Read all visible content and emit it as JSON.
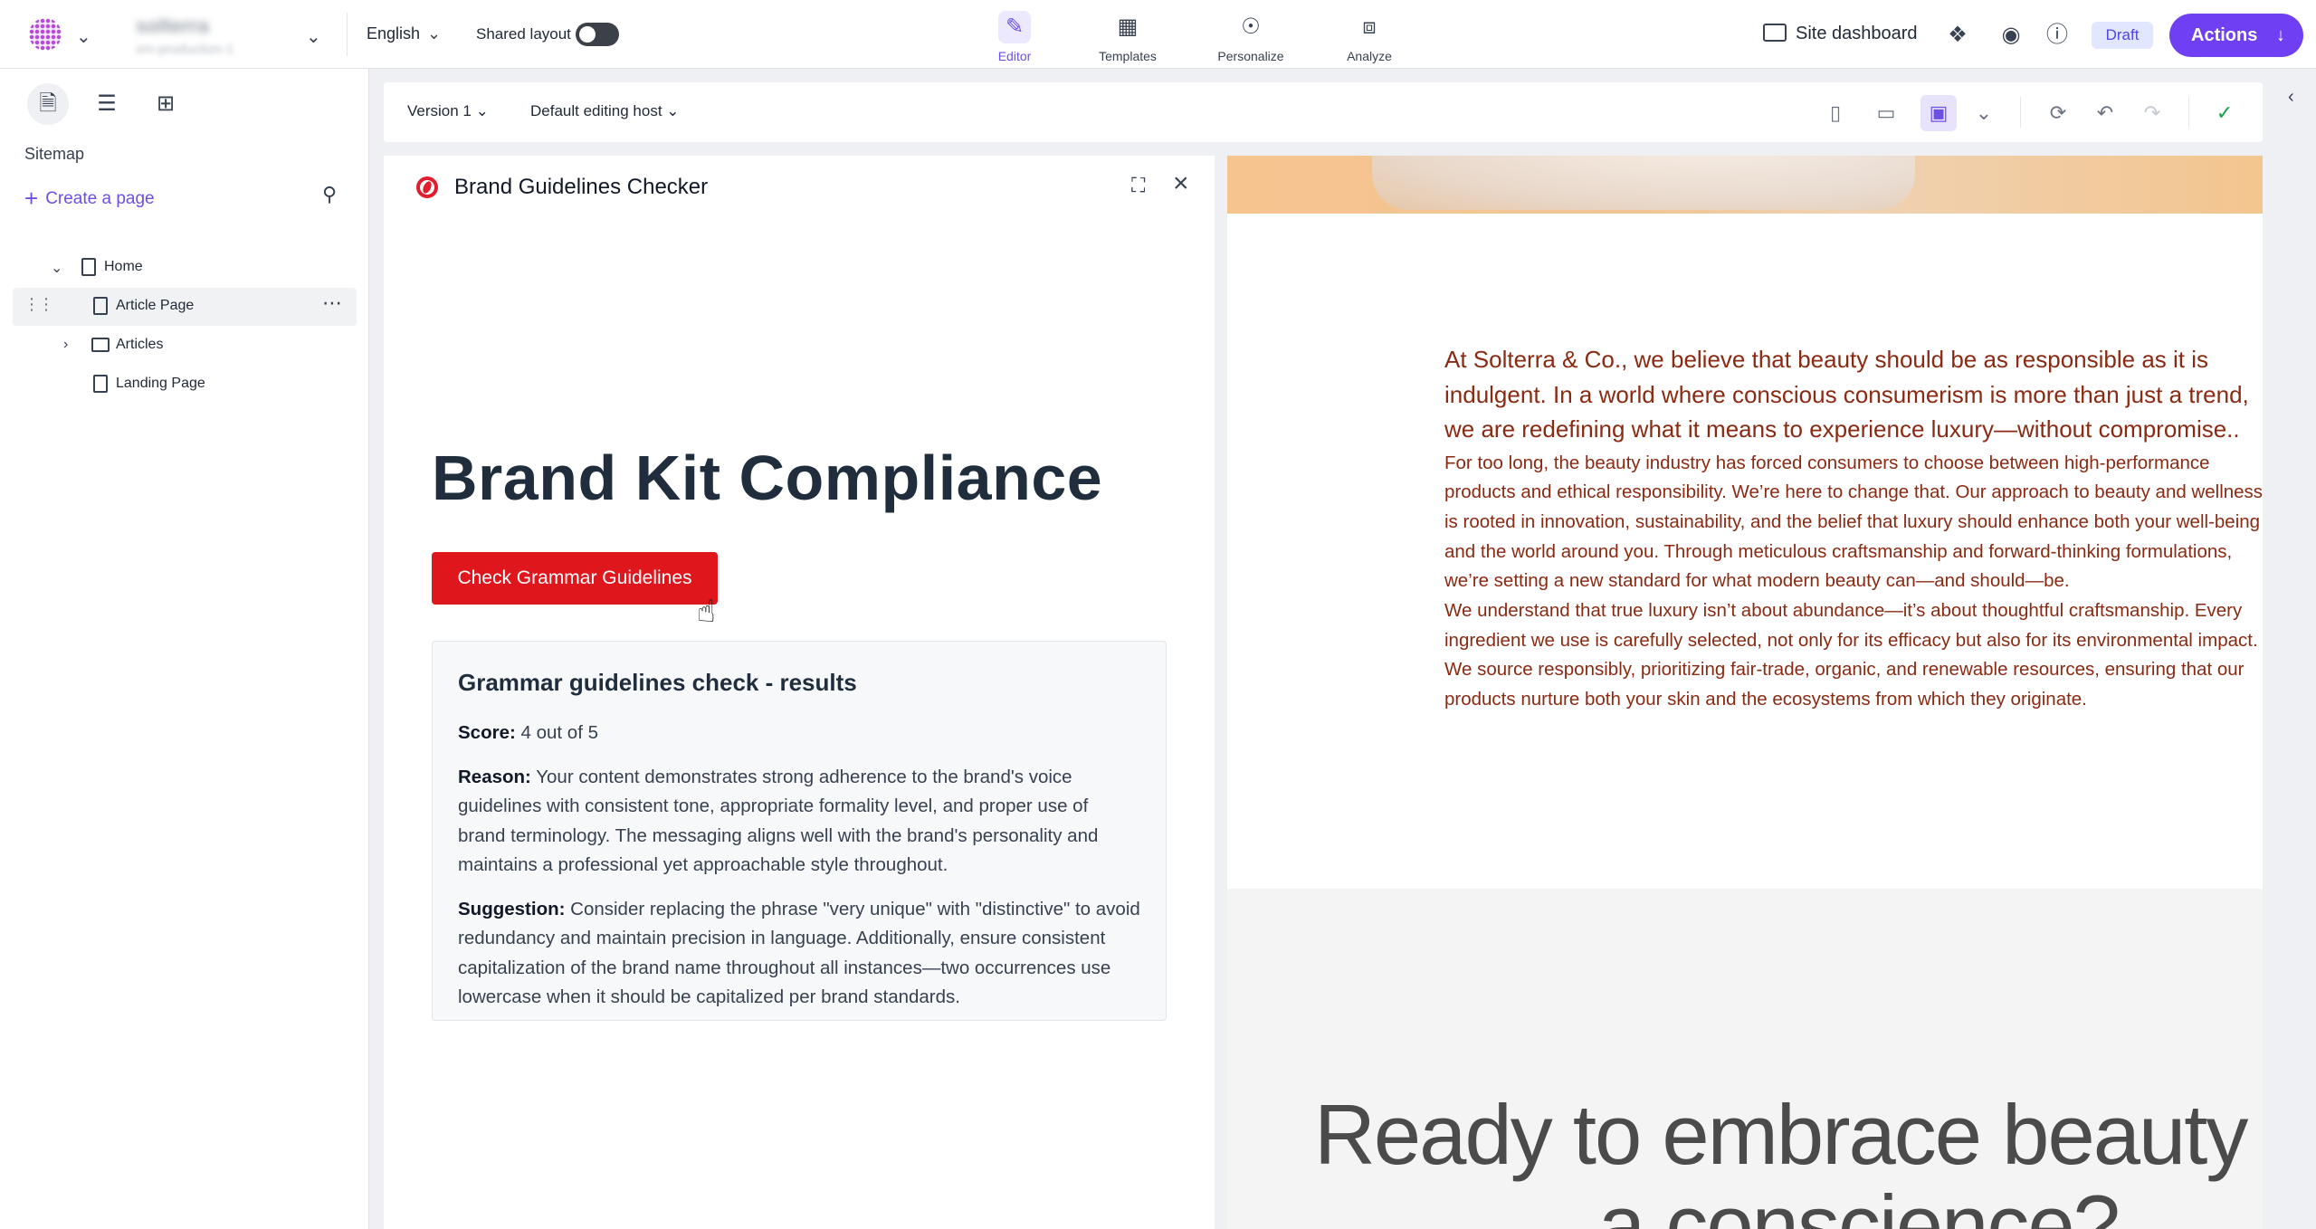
{
  "topbar": {
    "language": "English",
    "shared_layout_label": "Shared layout",
    "tenant_name": "solterra",
    "tenant_sub": "xm-production-1",
    "nav": [
      {
        "label": "Editor",
        "icon": "editor-icon",
        "active": true
      },
      {
        "label": "Templates",
        "icon": "templates-icon",
        "active": false
      },
      {
        "label": "Personalize",
        "icon": "personalize-icon",
        "active": false
      },
      {
        "label": "Analyze",
        "icon": "analyze-icon",
        "active": false
      }
    ],
    "site_dashboard": "Site dashboard",
    "draft": "Draft",
    "actions": "Actions"
  },
  "sidebar": {
    "title": "Sitemap",
    "create_page": "Create a page",
    "tree": [
      {
        "label": "Home",
        "type": "page",
        "expanded": true,
        "level": 0
      },
      {
        "label": "Article Page",
        "type": "page",
        "selected": true,
        "level": 1
      },
      {
        "label": "Articles",
        "type": "folder",
        "expanded": false,
        "level": 1
      },
      {
        "label": "Landing Page",
        "type": "page",
        "level": 1
      }
    ]
  },
  "editor_toolbar": {
    "version": "Version 1",
    "editing_host": "Default editing host"
  },
  "panel": {
    "title": "Brand Guidelines Checker",
    "heading": "Brand Kit Compliance",
    "button": "Check Grammar Guidelines",
    "results": {
      "title": "Grammar guidelines check - results",
      "score_label": "Score:",
      "score_value": "4 out of 5",
      "reason_label": "Reason:",
      "reason_text": "Your content demonstrates strong adherence to the brand's voice guidelines with consistent tone, appropriate formality level, and proper use of brand terminology. The messaging aligns well with the brand's personality and maintains a professional yet approachable style throughout.",
      "suggestion_label": "Suggestion:",
      "suggestion_text": "Consider replacing the phrase \"very unique\" with \"distinctive\" to avoid redundancy and maintain precision in language. Additionally, ensure consistent capitalization of the brand name throughout all instances—two occurrences use lowercase when it should be capitalized per brand standards."
    }
  },
  "preview": {
    "lead": "At Solterra & Co., we believe that beauty should be as responsible as it is indulgent. In a world where conscious consumerism is more than just a trend, we are redefining what it means to experience luxury—without compromise..",
    "para1": "For too long, the beauty industry has forced consumers to choose between high-performance products and ethical responsibility. We’re here to change that. Our approach to beauty and wellness is rooted in innovation, sustainability, and the belief that luxury should enhance both your well-being and the world around you. Through meticulous craftsmanship and forward-thinking formulations, we’re setting a new standard for what modern beauty can—and should—be.",
    "para2": "We understand that true luxury isn’t about abundance—it’s about thoughtful craftsmanship. Every ingredient we use is carefully selected, not only for its efficacy but also for its environmental impact. We source responsibly, prioritizing fair-trade, organic, and renewable resources, ensuring that our products nurture both your skin and the ecosystems from which they originate.",
    "cta_line1": "Ready to embrace beauty w",
    "cta_line2": "a conscience?"
  },
  "colors": {
    "accent": "#6e3ff3",
    "check_button": "#e0161d",
    "copy_text": "#8b2a12",
    "heading": "#1f2d3d"
  }
}
